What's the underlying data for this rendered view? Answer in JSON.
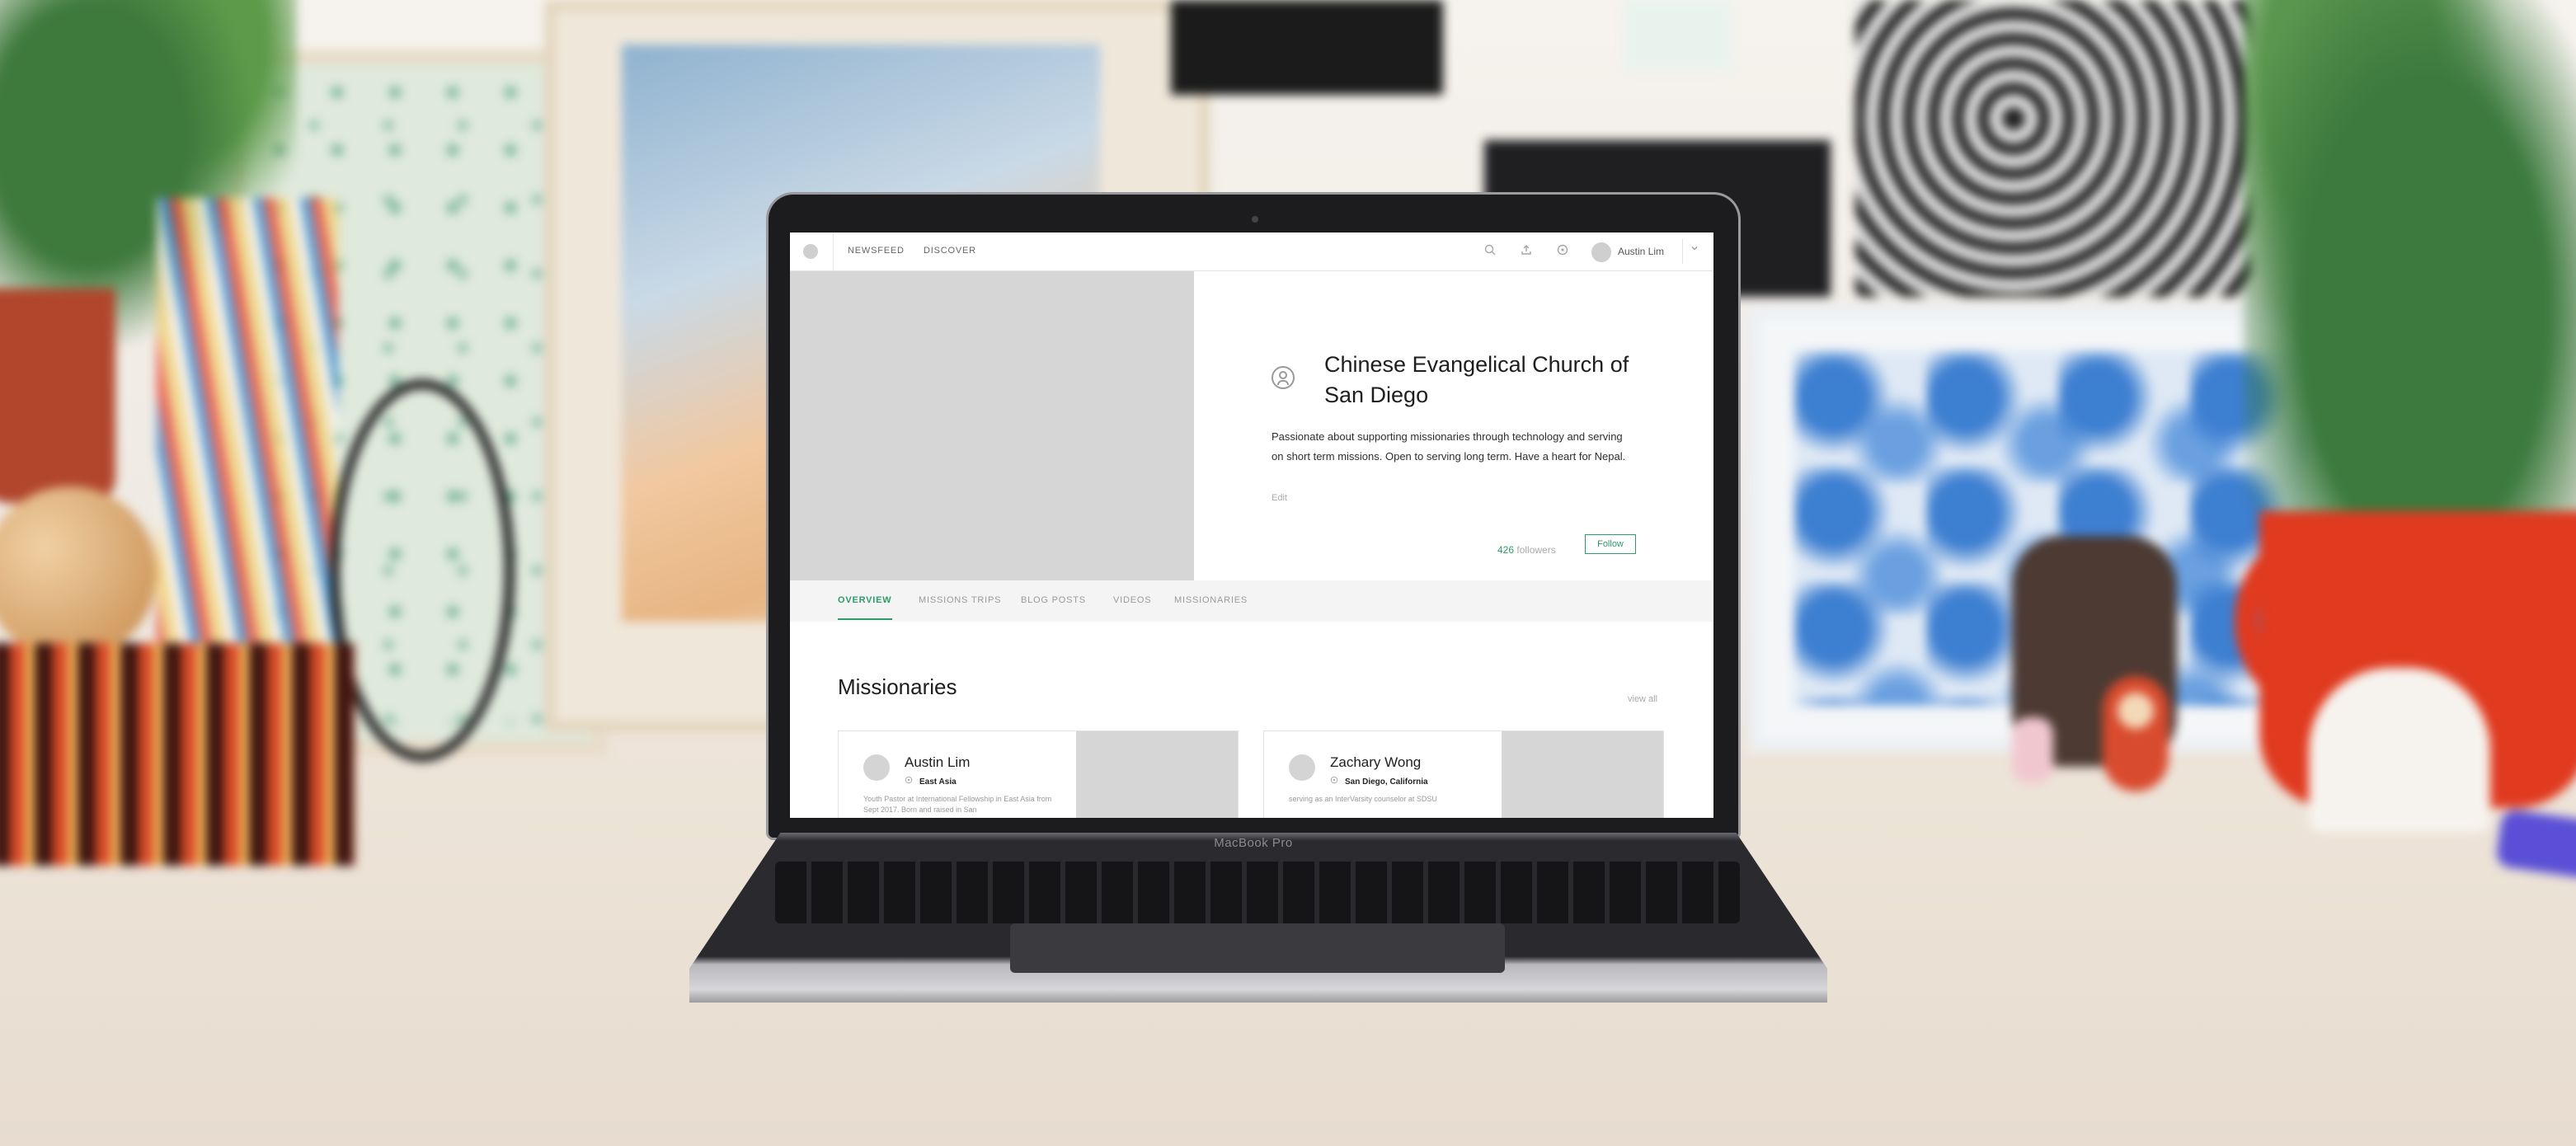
{
  "topbar": {
    "nav": [
      "NEWSFEED",
      "DISCOVER"
    ],
    "user_name": "Austin Lim"
  },
  "org": {
    "title": "Chinese Evangelical Church of San Diego",
    "description": "Passionate about supporting missionaries through technology and serving on short term missions.  Open to serving long term.  Have a heart for Nepal.",
    "edit_label": "Edit",
    "followers_count": "426",
    "followers_label": "followers",
    "follow_label": "Follow"
  },
  "tabs": [
    "OVERVIEW",
    "MISSIONS TRIPS",
    "BLOG POSTS",
    "VIDEOS",
    "MISSIONARIES"
  ],
  "missionaries": {
    "title": "Missionaries",
    "view_all": "view all",
    "cards": [
      {
        "name": "Austin Lim",
        "location": "East Asia",
        "bio": "Youth Pastor at International Fellowship in East Asia from Sept 2017. Born and raised in San"
      },
      {
        "name": "Zachary Wong",
        "location": "San Diego, California",
        "bio": "serving as an InterVarsity counselor at SDSU"
      }
    ]
  },
  "laptop": {
    "brand": "MacBook Pro"
  },
  "colors": {
    "accent": "#2f9a6a",
    "placeholder": "#d6d6d6"
  },
  "icons": [
    "search-icon",
    "upload-icon",
    "compass-icon",
    "chevron-down-icon",
    "user-circle-icon",
    "location-pin-icon"
  ]
}
